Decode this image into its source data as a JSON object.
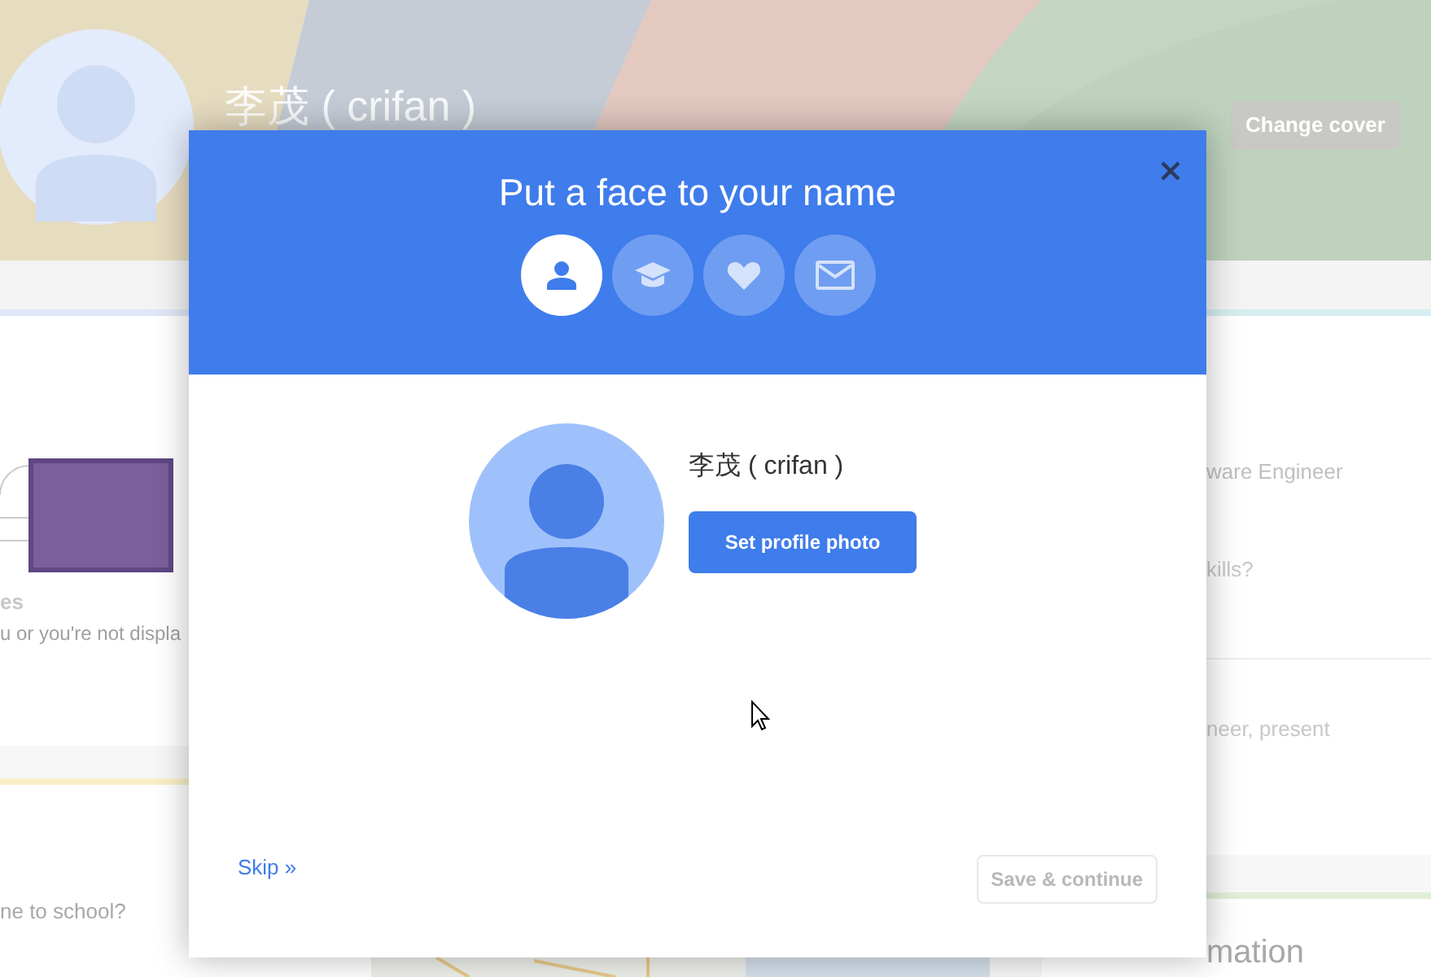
{
  "profile": {
    "name": "李茂 ( crifan )",
    "cover_button": "Change cover"
  },
  "left_card": {
    "heading": "es",
    "text": "u or you're not displa",
    "question": "ne to school?"
  },
  "right_card": {
    "job": "ware Engineer",
    "skills": "kills?",
    "position": "neer, present",
    "section_heading": "mation"
  },
  "dialog": {
    "title": "Put a face to your name",
    "steps": [
      {
        "kind": "person",
        "selected": true
      },
      {
        "kind": "education",
        "selected": false
      },
      {
        "kind": "heart",
        "selected": false
      },
      {
        "kind": "mail",
        "selected": false
      }
    ],
    "name": "李茂 ( crifan )",
    "photo_button": "Set profile photo",
    "skip_link": "Skip »",
    "save_button": {
      "label": "Save & continue",
      "disabled": true
    }
  }
}
